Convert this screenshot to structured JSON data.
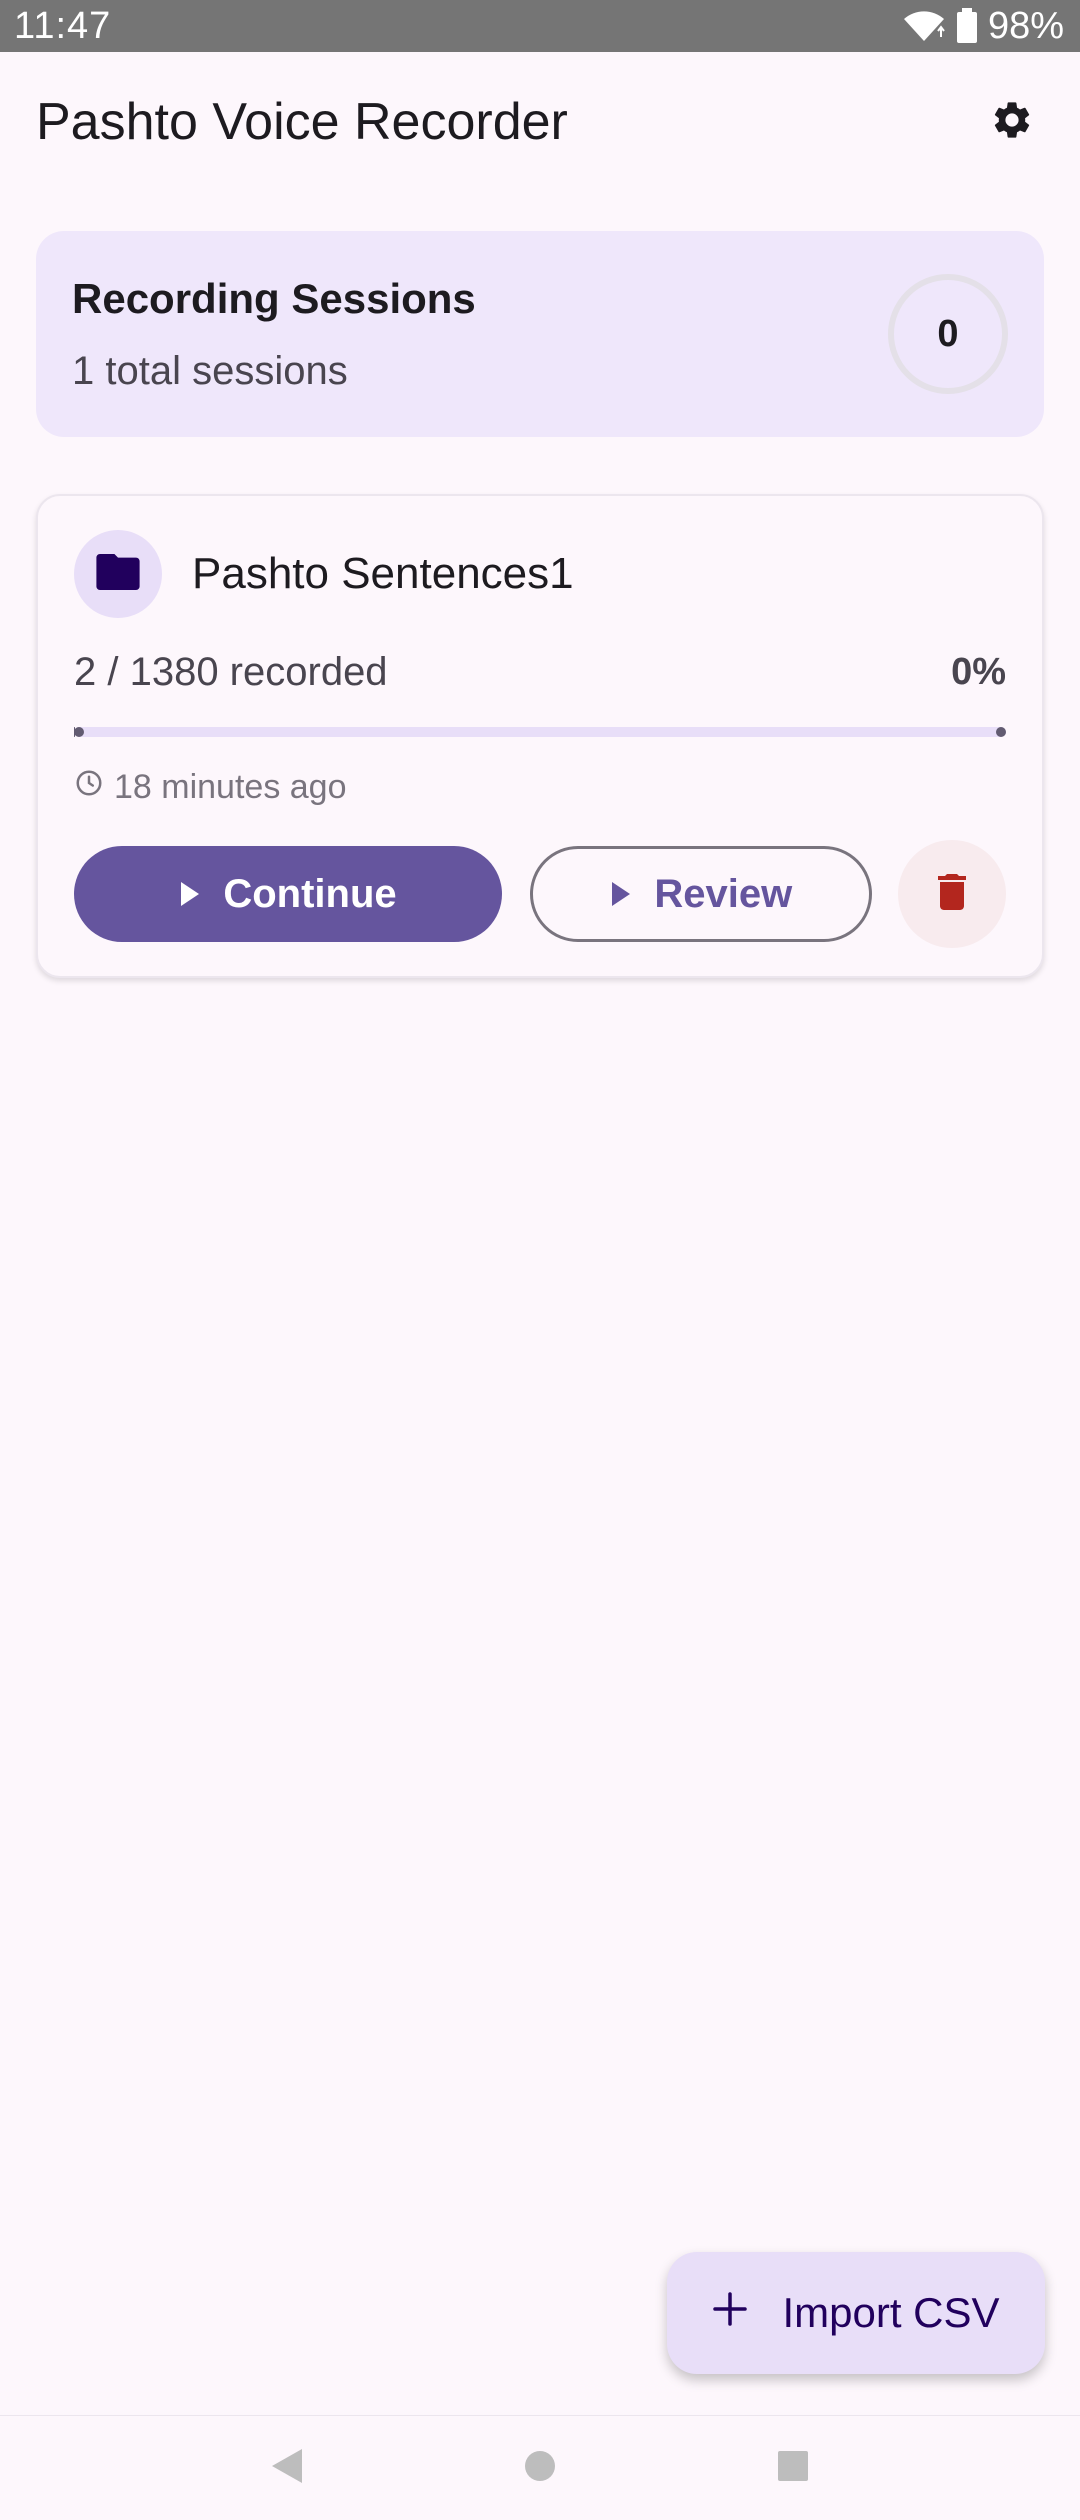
{
  "status_bar": {
    "time": "11:47",
    "battery": "98%",
    "icons": [
      "wifi-icon",
      "battery-icon"
    ]
  },
  "app_bar": {
    "title": "Pashto Voice Recorder",
    "settings_icon": "gear-icon"
  },
  "summary": {
    "title": "Recording Sessions",
    "subtitle": "1 total sessions",
    "count": "0"
  },
  "sessions": [
    {
      "name": "Pashto Sentences1",
      "icon": "folder-icon",
      "progress_text": "2 / 1380 recorded",
      "progress_percent": "0%",
      "progress_value": 0.0014,
      "last_updated": "18 minutes ago",
      "continue_label": "Continue",
      "review_label": "Review",
      "delete_icon": "trash-icon"
    }
  ],
  "fab": {
    "label": "Import CSV",
    "icon": "plus-icon"
  },
  "nav": {
    "buttons": [
      "back-icon",
      "home-icon",
      "recents-icon"
    ]
  },
  "colors": {
    "primary": "#65559e",
    "surface": "#fdf7fc",
    "summary_bg": "#efe7fb",
    "fab_bg": "#e8def8",
    "delete": "#b3261e"
  }
}
